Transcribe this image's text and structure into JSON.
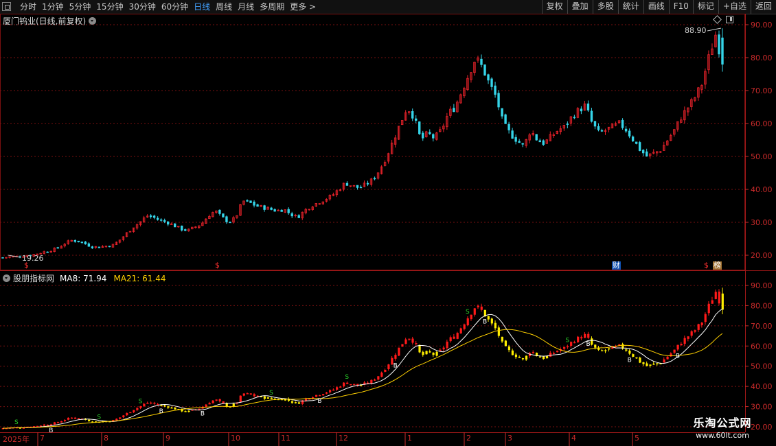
{
  "toolbar": {
    "periods": [
      "分时",
      "1分钟",
      "5分钟",
      "15分钟",
      "30分钟",
      "60分钟",
      "日线",
      "周线",
      "月线",
      "多周期",
      "更多 >"
    ],
    "active_period": "日线",
    "actions": [
      "复权",
      "叠加",
      "多股",
      "统计",
      "画线",
      "F10",
      "标记",
      "+自选",
      "返回"
    ]
  },
  "main_chart": {
    "title": "厦门钨业(日线,前复权)",
    "high_label": "88.90",
    "low_label": "19.26",
    "price_axis": [
      "90.00",
      "80.00",
      "70.00",
      "60.00",
      "50.00",
      "40.00",
      "30.00",
      "20.00"
    ],
    "markers": {
      "dollar": "$",
      "cai": "财",
      "bang": "榜"
    }
  },
  "sub_chart": {
    "title": "股朋指标网",
    "ma8_label": "MA8: 71.94",
    "ma21_label": "MA21: 61.44",
    "axis": [
      "90.00",
      "80.00",
      "70.00",
      "60.00",
      "50.00",
      "40.00",
      "30.00",
      "20.00"
    ],
    "signal_buy": "B",
    "signal_sell": "S"
  },
  "date_axis": {
    "year_label": "2025年",
    "months": [
      "7",
      "8",
      "9",
      "10",
      "11",
      "12",
      "1",
      "2",
      "3",
      "4",
      "5"
    ]
  },
  "watermark": {
    "line1": "乐淘公式网",
    "line2": "www.60lt.com"
  },
  "colors": {
    "up": "#e8222a",
    "down": "#35d4e8",
    "sub_up": "#ff1a1a",
    "sub_down": "#ffee00",
    "ma8": "#ffffff",
    "ma21": "#ffd000",
    "grid": "#7a1010"
  },
  "chart_data": {
    "type": "candlestick",
    "x_months": [
      "7",
      "8",
      "9",
      "10",
      "11",
      "12",
      "1",
      "2",
      "3",
      "4",
      "5"
    ],
    "ylim": [
      17,
      93
    ],
    "close_path": [
      19.3,
      19.5,
      19.6,
      19.8,
      20.0,
      20.5,
      21.0,
      21.5,
      22.2,
      23.5,
      24.5,
      24.3,
      23.5,
      22.6,
      22.5,
      22.8,
      23.0,
      24.5,
      26.5,
      28.5,
      30.0,
      32.0,
      31.5,
      30.5,
      30.0,
      29.0,
      28.0,
      27.5,
      28.5,
      29.5,
      32.0,
      33.5,
      31.5,
      30.0,
      31.5,
      36.5,
      36.0,
      35.0,
      34.5,
      34.0,
      33.5,
      34.0,
      32.5,
      31.5,
      33.5,
      35.0,
      36.0,
      37.0,
      38.0,
      40.0,
      42.0,
      41.0,
      40.5,
      41.5,
      43.0,
      46.0,
      50.0,
      55.0,
      60.0,
      65.0,
      62.0,
      55.0,
      57.0,
      55.5,
      58.0,
      63.0,
      65.0,
      70.0,
      75.0,
      80.0,
      77.0,
      72.0,
      68.0,
      60.0,
      57.0,
      55.0,
      53.0,
      58.0,
      55.0,
      54.0,
      56.0,
      58.0,
      59.0,
      62.0,
      64.0,
      65.5,
      60.0,
      57.0,
      58.0,
      59.0,
      60.0,
      58.0,
      55.0,
      52.0,
      50.0,
      51.0,
      52.0,
      55.0,
      58.0,
      62.0,
      65.0,
      68.0,
      72.0,
      80.0,
      87.0,
      78.0
    ],
    "ma8_last": 71.94,
    "ma21_last": 61.44,
    "high_annotation": 88.9,
    "low_annotation": 19.26
  }
}
